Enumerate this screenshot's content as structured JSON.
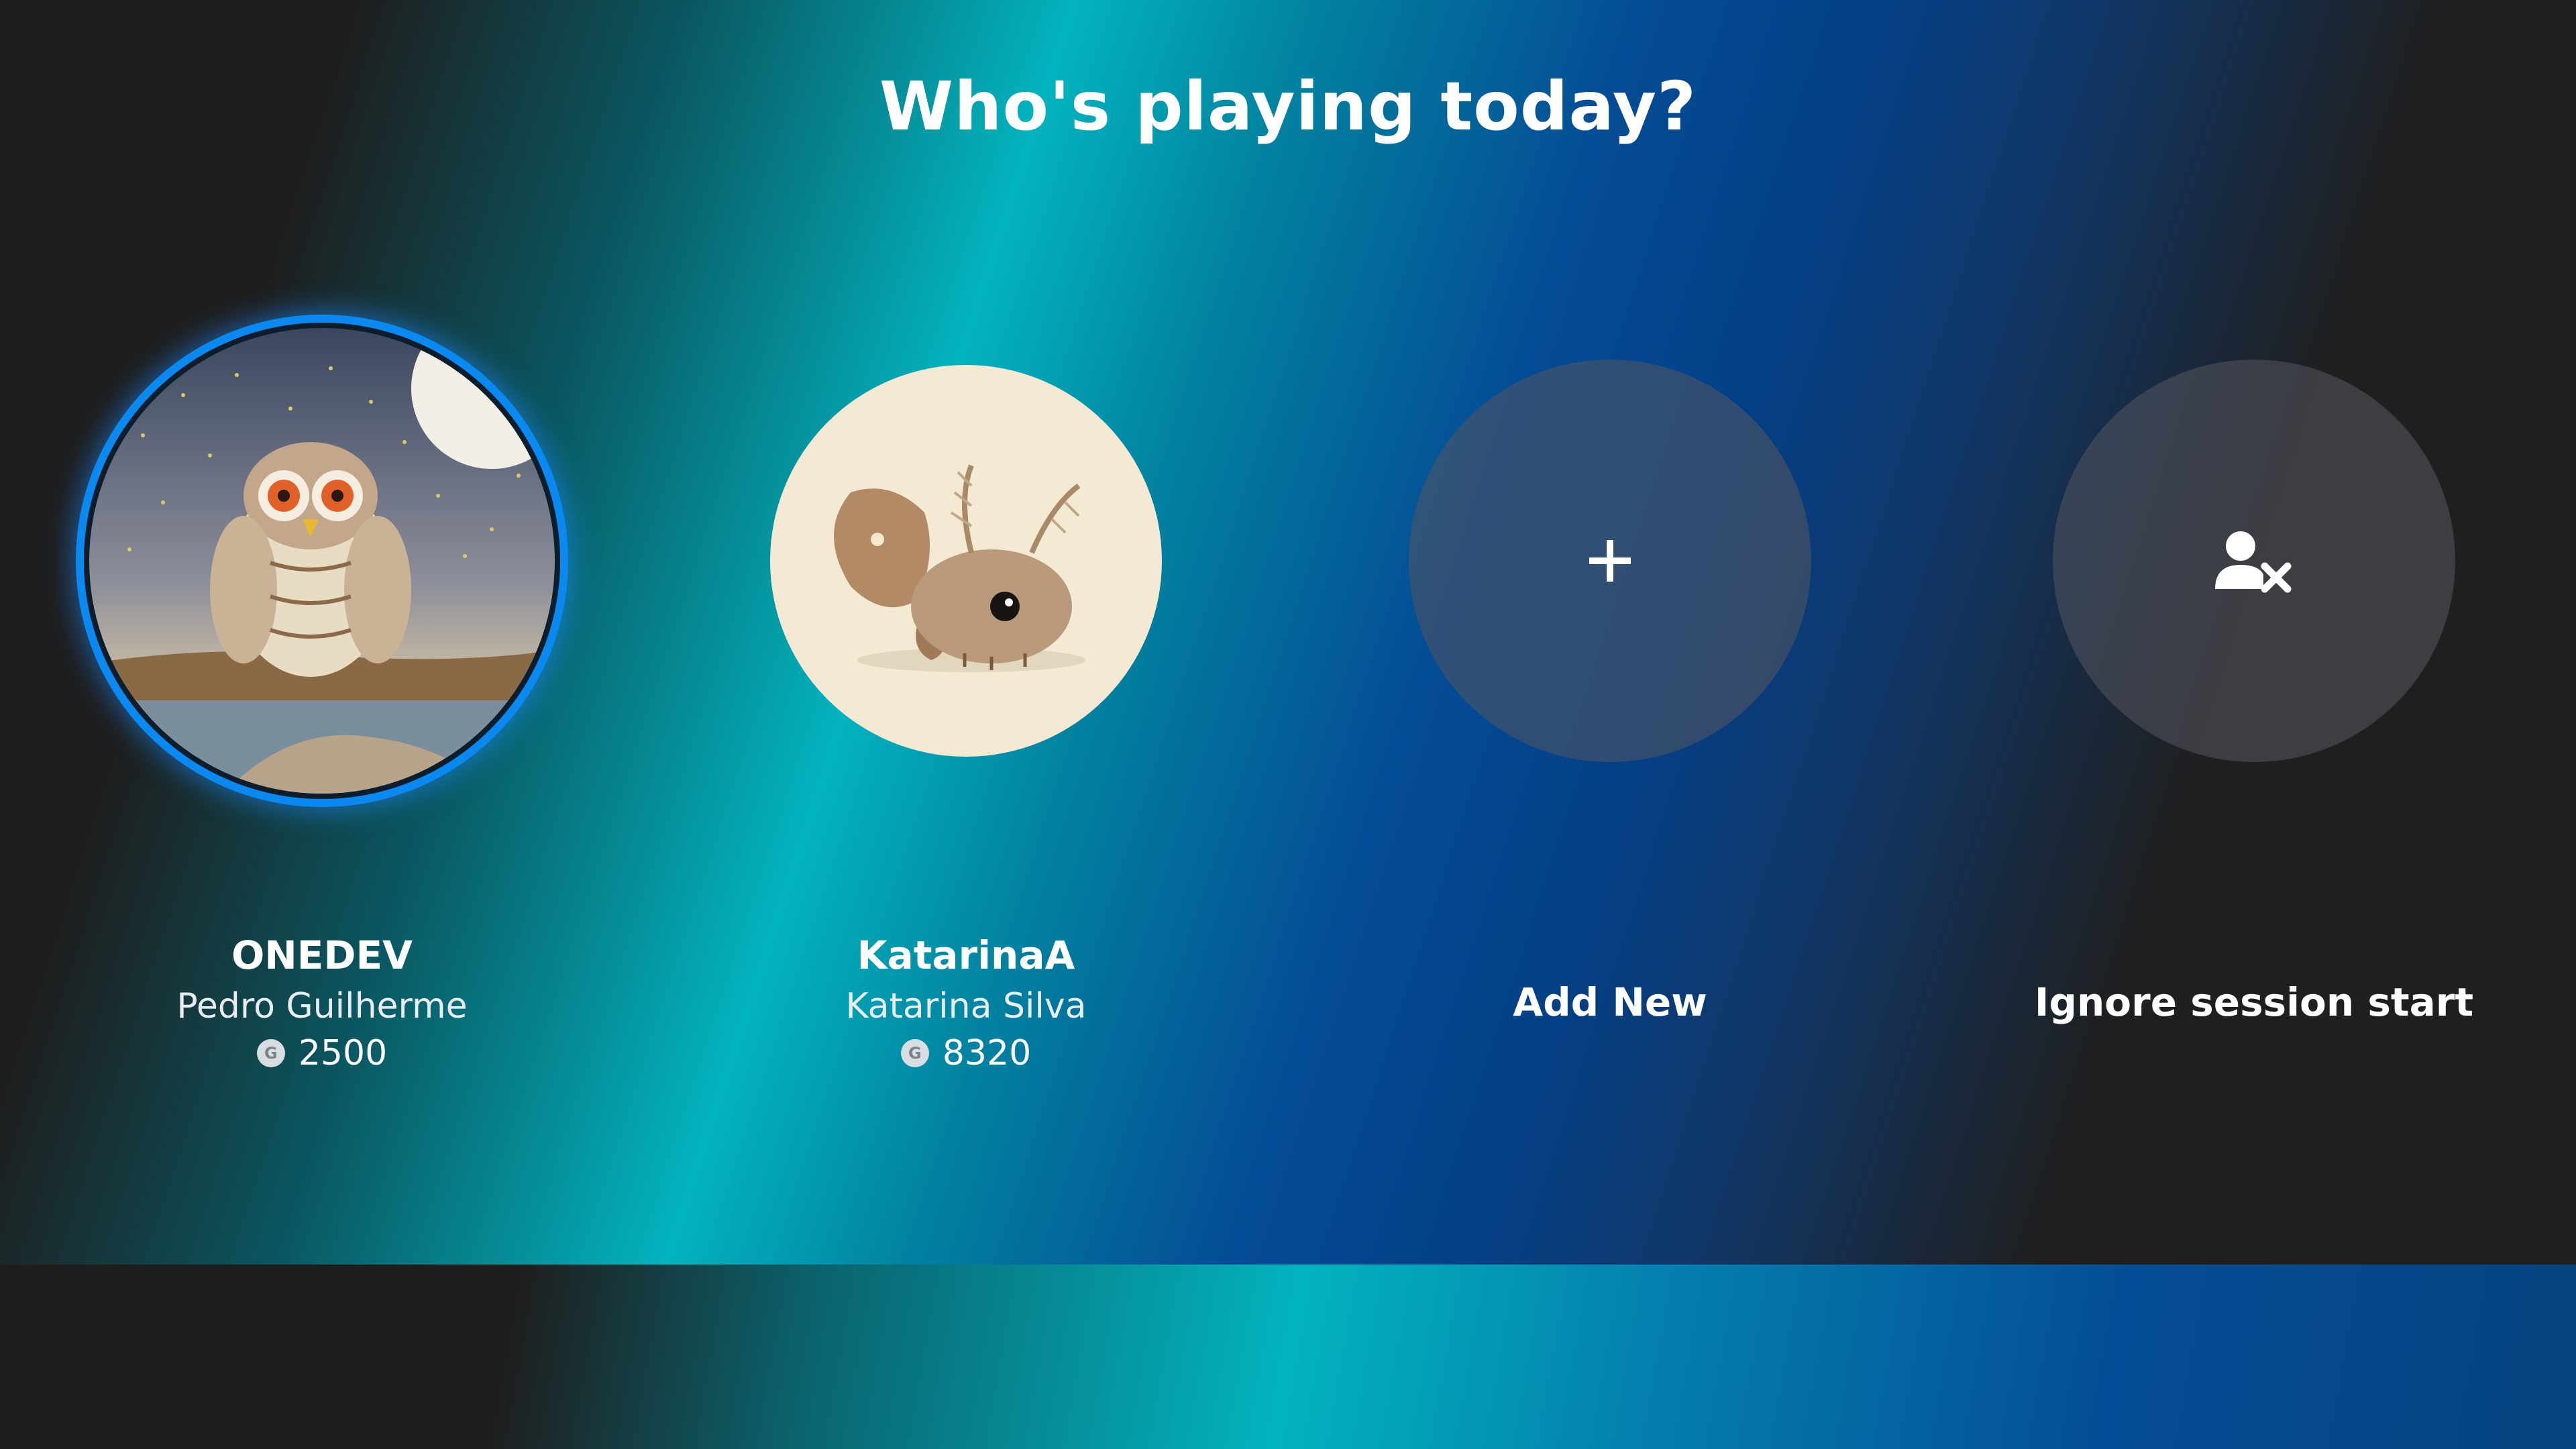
{
  "screen": {
    "title": "Who's playing today?"
  },
  "profiles": [
    {
      "gamertag": "ONEDEV",
      "name": "Pedro Guilherme",
      "score_icon": "G",
      "score": "2500",
      "avatar": "owl-avatar",
      "focused": true
    },
    {
      "gamertag": "KatarinaA",
      "name": "Katarina Silva",
      "score_icon": "G",
      "score": "8320",
      "avatar": "moth-creature-avatar",
      "focused": false
    }
  ],
  "actions": {
    "add_new": {
      "label": "Add New",
      "icon": "plus-icon"
    },
    "ignore": {
      "label": "Ignore session start",
      "icon": "remove-user-icon"
    }
  },
  "colors": {
    "focus_ring": "#0a8af0",
    "action_circle": "#55555f",
    "background_dark": "#1f1f1f",
    "gradient_teal": "#02b3be",
    "gradient_blue": "#044c95"
  }
}
